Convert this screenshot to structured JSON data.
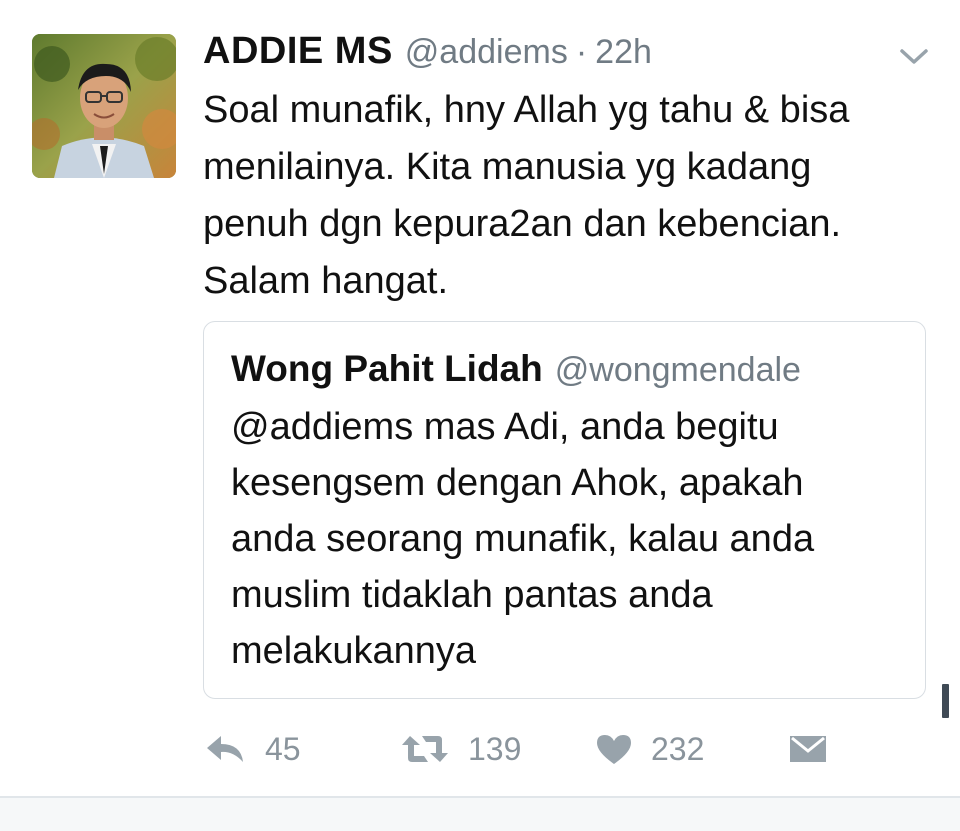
{
  "tweet": {
    "author": {
      "display_name": "ADDIE MS",
      "handle": "@addiems",
      "avatar_icon": "user-avatar-photo"
    },
    "separator": "·",
    "timestamp": "22h",
    "text_lines": [
      "Soal munafik, hny Allah yg tahu & bisa",
      "menilainya. Kita manusia yg kadang",
      "penuh dgn kepura2an dan kebencian.",
      "Salam hangat."
    ],
    "menu_icon": "chevron-down-icon",
    "quoted": {
      "display_name": "Wong Pahit Lidah",
      "handle": "@wongmendale",
      "text_lines": [
        "@addiems mas Adi, anda begitu",
        "kesengsem dengan Ahok, apakah",
        "anda seorang munafik, kalau anda",
        "muslim tidaklah pantas anda",
        "melakukannya"
      ]
    },
    "actions": {
      "reply": {
        "icon": "reply-icon",
        "count": "45"
      },
      "retweet": {
        "icon": "retweet-icon",
        "count": "139"
      },
      "like": {
        "icon": "heart-icon",
        "count": "232"
      },
      "message": {
        "icon": "envelope-icon"
      }
    }
  },
  "colors": {
    "text": "#111111",
    "secondary": "#707b84",
    "action_gray": "#8a949c",
    "border": "#d9dee3"
  }
}
